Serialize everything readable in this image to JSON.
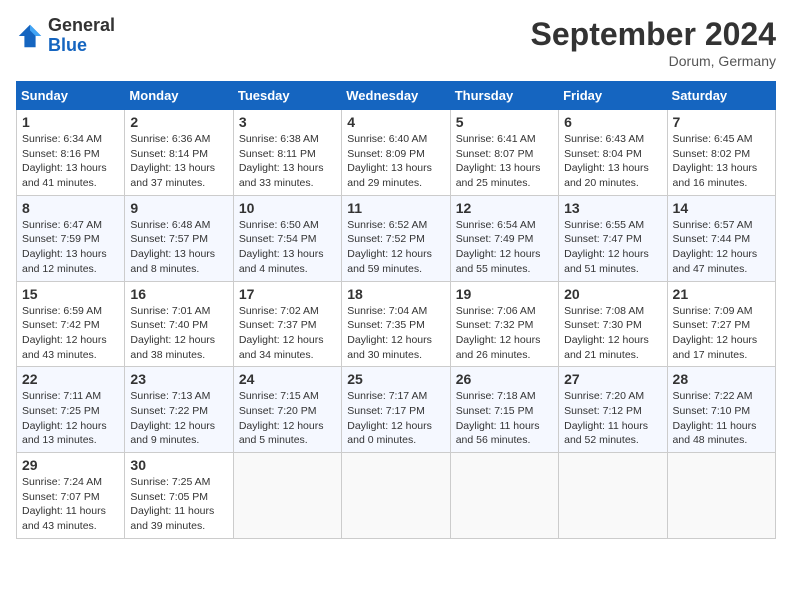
{
  "header": {
    "logo_general": "General",
    "logo_blue": "Blue",
    "month_year": "September 2024",
    "location": "Dorum, Germany"
  },
  "columns": [
    "Sunday",
    "Monday",
    "Tuesday",
    "Wednesday",
    "Thursday",
    "Friday",
    "Saturday"
  ],
  "weeks": [
    [
      {
        "day": "1",
        "sunrise": "Sunrise: 6:34 AM",
        "sunset": "Sunset: 8:16 PM",
        "daylight": "Daylight: 13 hours and 41 minutes."
      },
      {
        "day": "2",
        "sunrise": "Sunrise: 6:36 AM",
        "sunset": "Sunset: 8:14 PM",
        "daylight": "Daylight: 13 hours and 37 minutes."
      },
      {
        "day": "3",
        "sunrise": "Sunrise: 6:38 AM",
        "sunset": "Sunset: 8:11 PM",
        "daylight": "Daylight: 13 hours and 33 minutes."
      },
      {
        "day": "4",
        "sunrise": "Sunrise: 6:40 AM",
        "sunset": "Sunset: 8:09 PM",
        "daylight": "Daylight: 13 hours and 29 minutes."
      },
      {
        "day": "5",
        "sunrise": "Sunrise: 6:41 AM",
        "sunset": "Sunset: 8:07 PM",
        "daylight": "Daylight: 13 hours and 25 minutes."
      },
      {
        "day": "6",
        "sunrise": "Sunrise: 6:43 AM",
        "sunset": "Sunset: 8:04 PM",
        "daylight": "Daylight: 13 hours and 20 minutes."
      },
      {
        "day": "7",
        "sunrise": "Sunrise: 6:45 AM",
        "sunset": "Sunset: 8:02 PM",
        "daylight": "Daylight: 13 hours and 16 minutes."
      }
    ],
    [
      {
        "day": "8",
        "sunrise": "Sunrise: 6:47 AM",
        "sunset": "Sunset: 7:59 PM",
        "daylight": "Daylight: 13 hours and 12 minutes."
      },
      {
        "day": "9",
        "sunrise": "Sunrise: 6:48 AM",
        "sunset": "Sunset: 7:57 PM",
        "daylight": "Daylight: 13 hours and 8 minutes."
      },
      {
        "day": "10",
        "sunrise": "Sunrise: 6:50 AM",
        "sunset": "Sunset: 7:54 PM",
        "daylight": "Daylight: 13 hours and 4 minutes."
      },
      {
        "day": "11",
        "sunrise": "Sunrise: 6:52 AM",
        "sunset": "Sunset: 7:52 PM",
        "daylight": "Daylight: 12 hours and 59 minutes."
      },
      {
        "day": "12",
        "sunrise": "Sunrise: 6:54 AM",
        "sunset": "Sunset: 7:49 PM",
        "daylight": "Daylight: 12 hours and 55 minutes."
      },
      {
        "day": "13",
        "sunrise": "Sunrise: 6:55 AM",
        "sunset": "Sunset: 7:47 PM",
        "daylight": "Daylight: 12 hours and 51 minutes."
      },
      {
        "day": "14",
        "sunrise": "Sunrise: 6:57 AM",
        "sunset": "Sunset: 7:44 PM",
        "daylight": "Daylight: 12 hours and 47 minutes."
      }
    ],
    [
      {
        "day": "15",
        "sunrise": "Sunrise: 6:59 AM",
        "sunset": "Sunset: 7:42 PM",
        "daylight": "Daylight: 12 hours and 43 minutes."
      },
      {
        "day": "16",
        "sunrise": "Sunrise: 7:01 AM",
        "sunset": "Sunset: 7:40 PM",
        "daylight": "Daylight: 12 hours and 38 minutes."
      },
      {
        "day": "17",
        "sunrise": "Sunrise: 7:02 AM",
        "sunset": "Sunset: 7:37 PM",
        "daylight": "Daylight: 12 hours and 34 minutes."
      },
      {
        "day": "18",
        "sunrise": "Sunrise: 7:04 AM",
        "sunset": "Sunset: 7:35 PM",
        "daylight": "Daylight: 12 hours and 30 minutes."
      },
      {
        "day": "19",
        "sunrise": "Sunrise: 7:06 AM",
        "sunset": "Sunset: 7:32 PM",
        "daylight": "Daylight: 12 hours and 26 minutes."
      },
      {
        "day": "20",
        "sunrise": "Sunrise: 7:08 AM",
        "sunset": "Sunset: 7:30 PM",
        "daylight": "Daylight: 12 hours and 21 minutes."
      },
      {
        "day": "21",
        "sunrise": "Sunrise: 7:09 AM",
        "sunset": "Sunset: 7:27 PM",
        "daylight": "Daylight: 12 hours and 17 minutes."
      }
    ],
    [
      {
        "day": "22",
        "sunrise": "Sunrise: 7:11 AM",
        "sunset": "Sunset: 7:25 PM",
        "daylight": "Daylight: 12 hours and 13 minutes."
      },
      {
        "day": "23",
        "sunrise": "Sunrise: 7:13 AM",
        "sunset": "Sunset: 7:22 PM",
        "daylight": "Daylight: 12 hours and 9 minutes."
      },
      {
        "day": "24",
        "sunrise": "Sunrise: 7:15 AM",
        "sunset": "Sunset: 7:20 PM",
        "daylight": "Daylight: 12 hours and 5 minutes."
      },
      {
        "day": "25",
        "sunrise": "Sunrise: 7:17 AM",
        "sunset": "Sunset: 7:17 PM",
        "daylight": "Daylight: 12 hours and 0 minutes."
      },
      {
        "day": "26",
        "sunrise": "Sunrise: 7:18 AM",
        "sunset": "Sunset: 7:15 PM",
        "daylight": "Daylight: 11 hours and 56 minutes."
      },
      {
        "day": "27",
        "sunrise": "Sunrise: 7:20 AM",
        "sunset": "Sunset: 7:12 PM",
        "daylight": "Daylight: 11 hours and 52 minutes."
      },
      {
        "day": "28",
        "sunrise": "Sunrise: 7:22 AM",
        "sunset": "Sunset: 7:10 PM",
        "daylight": "Daylight: 11 hours and 48 minutes."
      }
    ],
    [
      {
        "day": "29",
        "sunrise": "Sunrise: 7:24 AM",
        "sunset": "Sunset: 7:07 PM",
        "daylight": "Daylight: 11 hours and 43 minutes."
      },
      {
        "day": "30",
        "sunrise": "Sunrise: 7:25 AM",
        "sunset": "Sunset: 7:05 PM",
        "daylight": "Daylight: 11 hours and 39 minutes."
      },
      null,
      null,
      null,
      null,
      null
    ]
  ]
}
